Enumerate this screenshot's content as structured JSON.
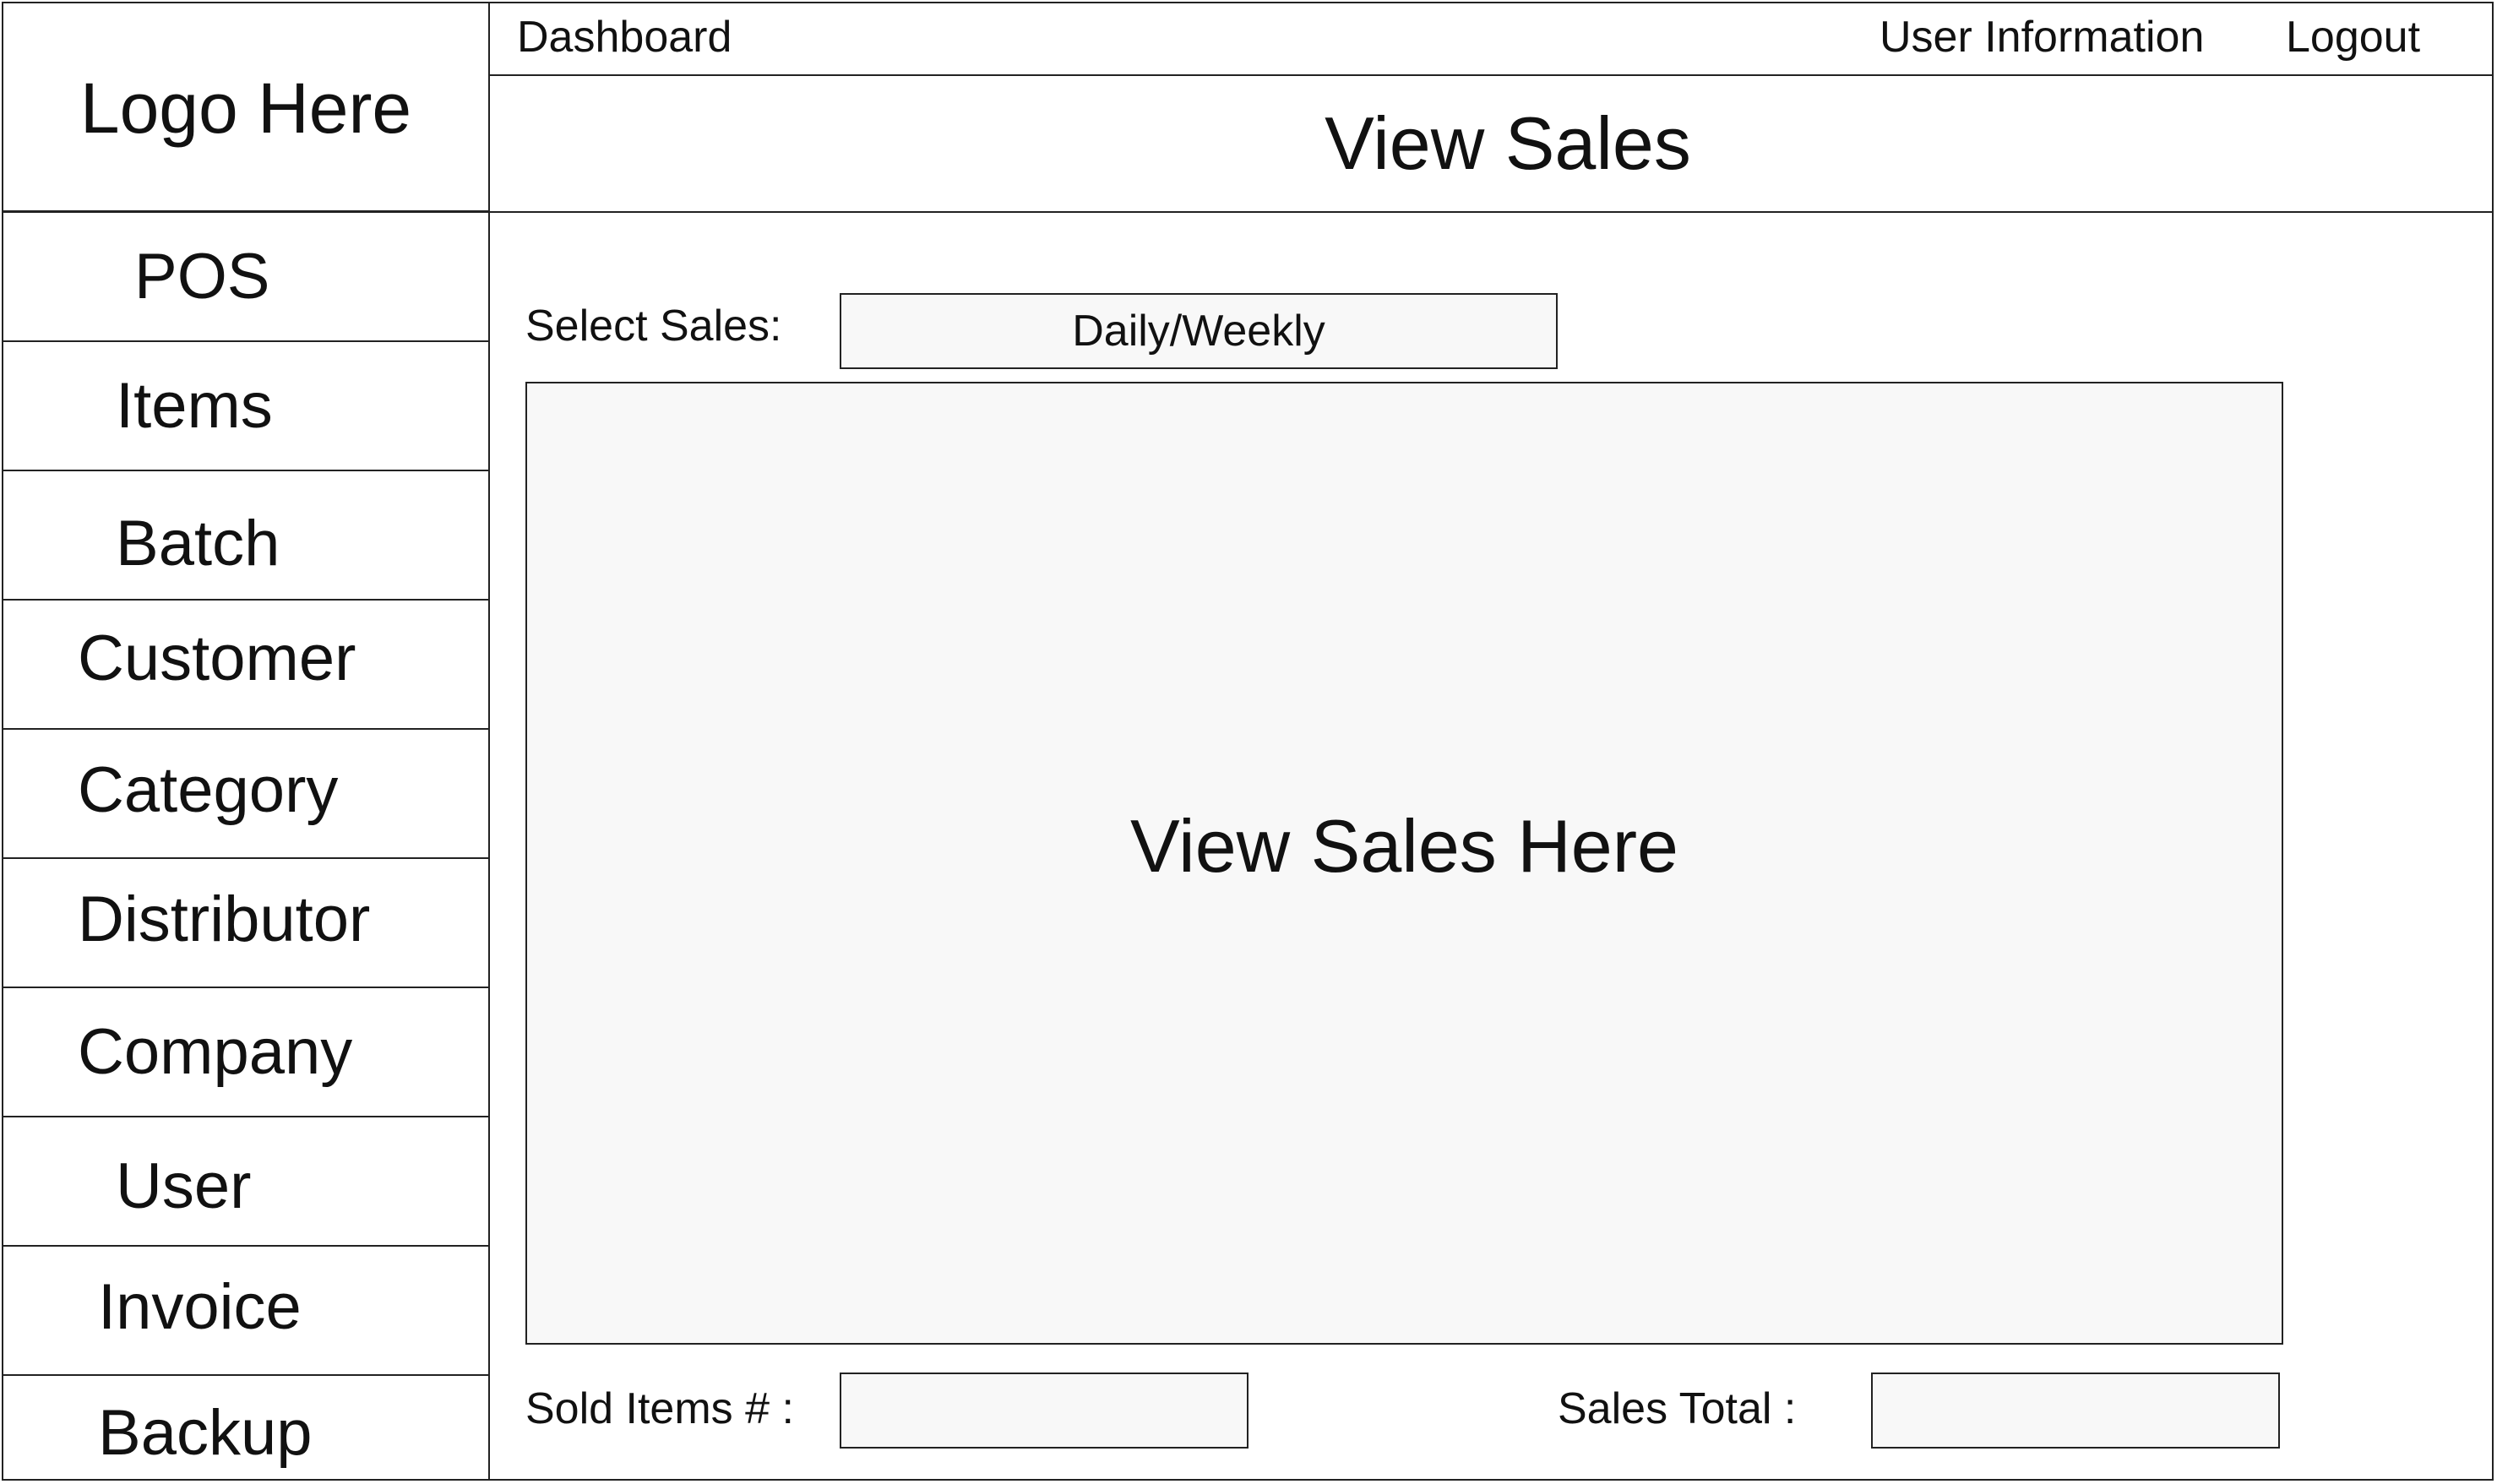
{
  "logo": {
    "text": "Logo Here"
  },
  "sidebar": {
    "items": [
      {
        "label": "POS"
      },
      {
        "label": "Items"
      },
      {
        "label": "Batch"
      },
      {
        "label": "Customer"
      },
      {
        "label": "Category"
      },
      {
        "label": "Distributor"
      },
      {
        "label": "Company"
      },
      {
        "label": "User"
      },
      {
        "label": "Invoice"
      },
      {
        "label": "Backup"
      }
    ]
  },
  "header": {
    "dashboard_label": "Dashboard",
    "user_info_label": "User Information",
    "logout_label": "Logout"
  },
  "page": {
    "title": "View Sales"
  },
  "filter": {
    "label": "Select Sales:",
    "selected_value": "Daily/Weekly"
  },
  "sales_panel": {
    "placeholder": "View Sales Here"
  },
  "footer": {
    "sold_items_label": "Sold Items # :",
    "sold_items_value": "",
    "sales_total_label": "Sales Total :",
    "sales_total_value": ""
  }
}
